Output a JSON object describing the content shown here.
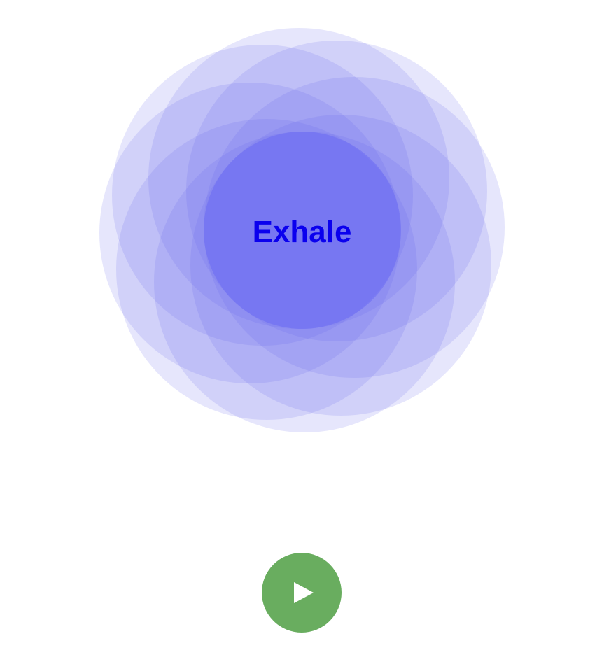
{
  "breath": {
    "phase_label": "Exhale"
  },
  "controls": {
    "play_icon": "play-icon",
    "button_color": "#69ad5f"
  },
  "colors": {
    "petal": "#6363ee",
    "label": "#0a00ee"
  }
}
